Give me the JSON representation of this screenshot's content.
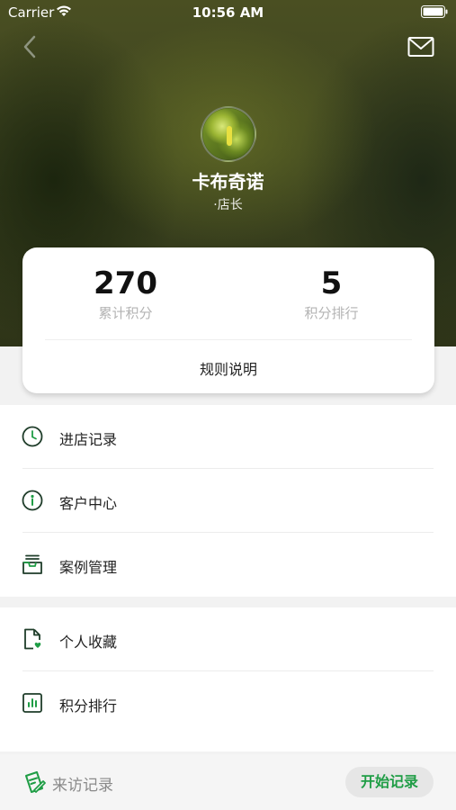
{
  "status_bar": {
    "carrier": "Carrier",
    "time": "10:56 AM"
  },
  "profile": {
    "name": "卡布奇诺",
    "role": "·店长"
  },
  "stats": {
    "total_points": {
      "value": "270",
      "label": "累计积分"
    },
    "points_rank": {
      "value": "5",
      "label": "积分排行"
    },
    "rules_label": "规则说明"
  },
  "menu": {
    "group1": [
      {
        "label": "进店记录",
        "icon": "clock-icon"
      },
      {
        "label": "客户中心",
        "icon": "customer-icon"
      },
      {
        "label": "案例管理",
        "icon": "inbox-icon"
      }
    ],
    "group2": [
      {
        "label": "个人收藏",
        "icon": "favorite-document-icon"
      },
      {
        "label": "积分排行",
        "icon": "bar-chart-icon"
      }
    ]
  },
  "bottom_bar": {
    "visit_label": "来访记录",
    "start_label": "开始记录"
  },
  "colors": {
    "accent": "#1f9d45",
    "icon": "#1f3d2a"
  }
}
